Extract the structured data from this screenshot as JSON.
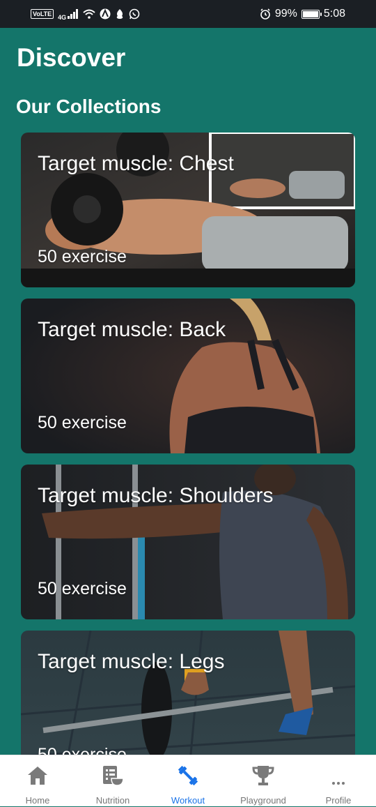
{
  "status_bar": {
    "left_indicators": [
      "VoLTE",
      "4G"
    ],
    "battery": "99%",
    "time": "5:08",
    "battery_level": 0.99
  },
  "header": {
    "title": "Discover"
  },
  "section": {
    "title": "Our Collections"
  },
  "collections": [
    {
      "title": "Target muscle: Chest",
      "subtitle": "50 exercise"
    },
    {
      "title": "Target muscle: Back",
      "subtitle": "50 exercise"
    },
    {
      "title": "Target muscle: Shoulders",
      "subtitle": "50 exercise"
    },
    {
      "title": "Target muscle: Legs",
      "subtitle": "50 exercise"
    }
  ],
  "bottom_nav": {
    "items": [
      {
        "label": "Home",
        "icon": "home-icon"
      },
      {
        "label": "Nutrition",
        "icon": "nutrition-icon"
      },
      {
        "label": "Workout",
        "icon": "dumbbell-icon"
      },
      {
        "label": "Playground",
        "icon": "trophy-icon"
      },
      {
        "label": "Profile",
        "icon": "more-icon"
      }
    ],
    "active": "Workout",
    "active_color": "#1a73e8",
    "inactive_color": "#777777"
  },
  "colors": {
    "background": "#14756a",
    "status_bar": "#1b1f24"
  }
}
